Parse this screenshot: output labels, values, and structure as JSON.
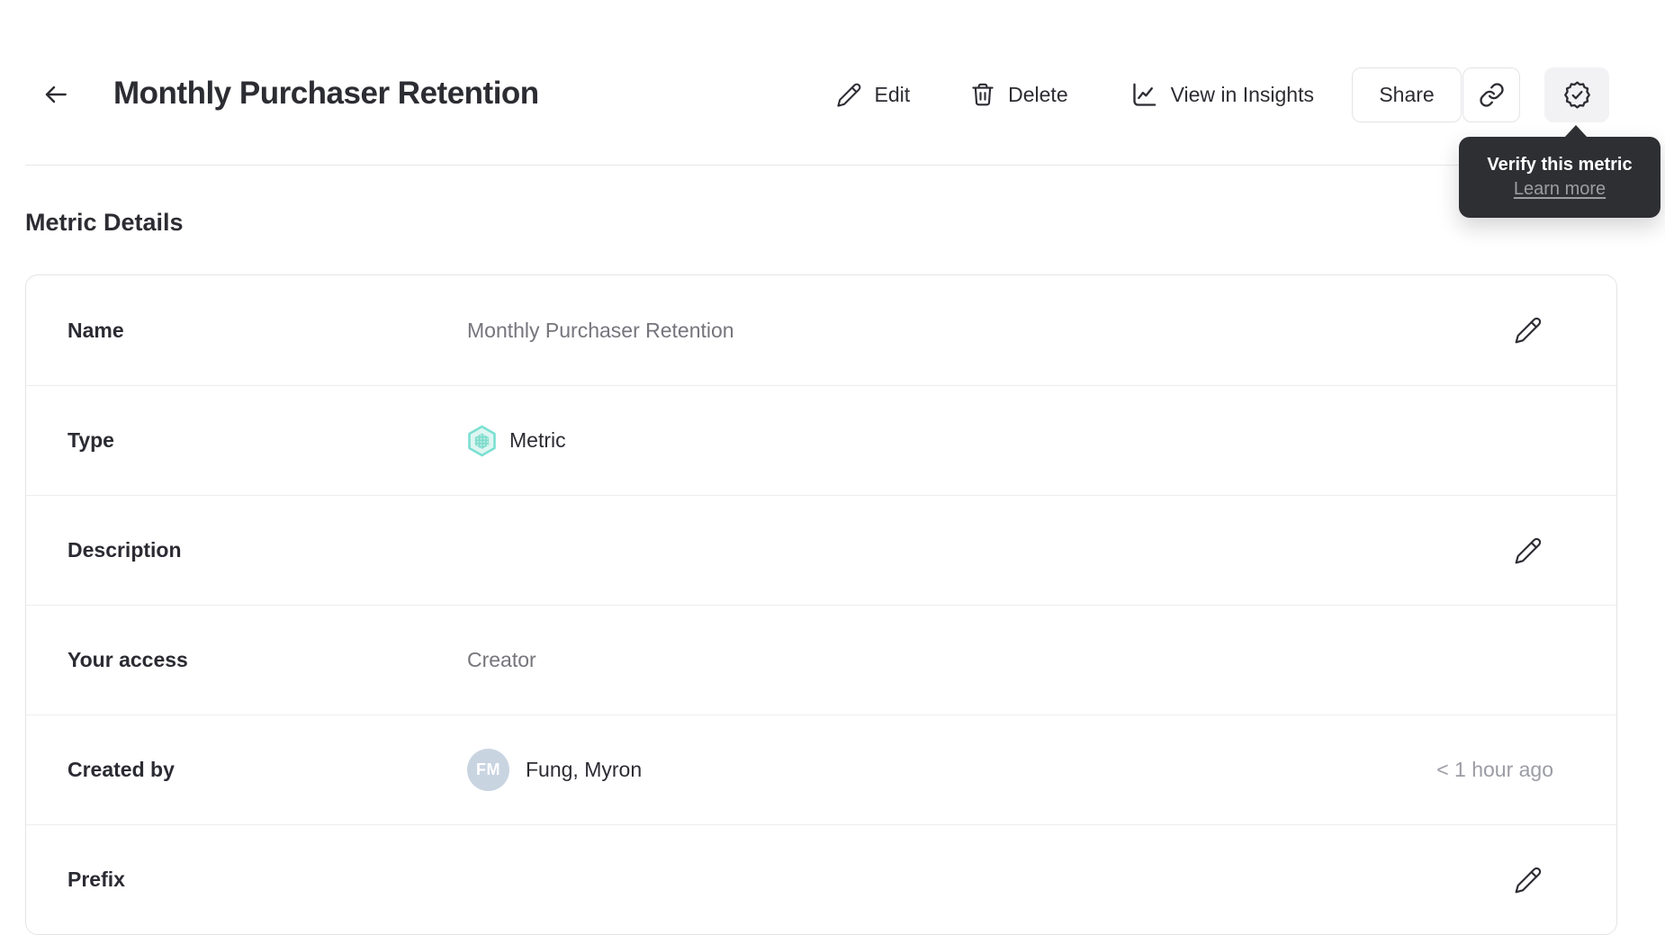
{
  "header": {
    "title": "Monthly Purchaser Retention",
    "actions": {
      "edit": "Edit",
      "delete": "Delete",
      "view_in_insights": "View in Insights",
      "share": "Share"
    }
  },
  "verify_tooltip": {
    "title": "Verify this metric",
    "link_label": "Learn more"
  },
  "section_title": "Metric Details",
  "metric_details": {
    "rows": [
      {
        "label": "Name",
        "value": "Monthly Purchaser Retention",
        "editable": true
      },
      {
        "label": "Type",
        "value": "Metric",
        "icon": "metric-hexagon-icon"
      },
      {
        "label": "Description",
        "value": "",
        "editable": true
      },
      {
        "label": "Your access",
        "value": "Creator"
      },
      {
        "label": "Created by",
        "value": "Fung, Myron",
        "avatar_initials": "FM",
        "timestamp": "< 1 hour ago"
      },
      {
        "label": "Prefix",
        "value": "",
        "editable": true
      }
    ]
  },
  "icons": {
    "back": "arrow-left-icon",
    "edit": "pencil-icon",
    "delete": "trash-icon",
    "insights": "line-chart-icon",
    "copy_link": "link-icon",
    "verify": "verified-badge-icon"
  },
  "colors": {
    "text_primary": "#2c2c33",
    "text_secondary": "#75757c",
    "text_muted": "#9b9ca4",
    "border": "#e4e4e8",
    "tooltip_bg": "#2e2f33",
    "accent_teal": "#7be0d2",
    "accent_teal_fill": "#def6f2",
    "avatar_bg": "#c9d4e1",
    "verify_button_bg": "#f2f2f5"
  }
}
